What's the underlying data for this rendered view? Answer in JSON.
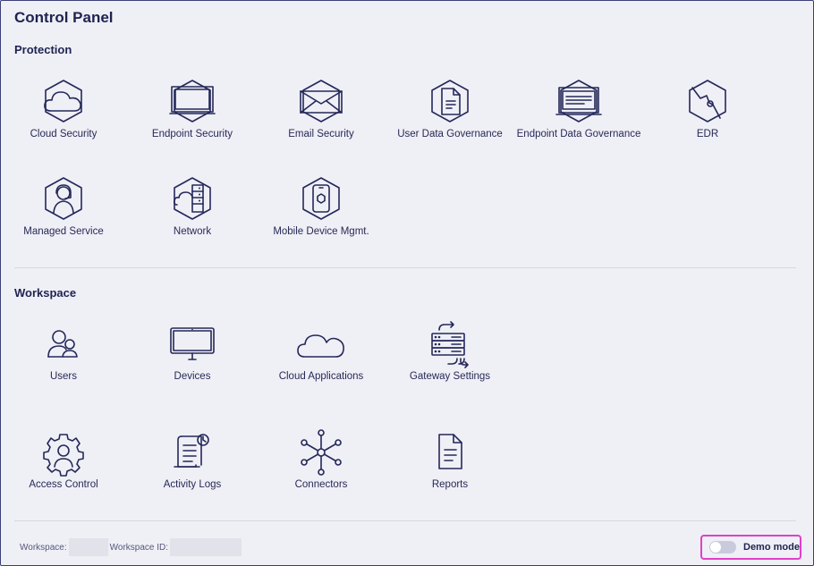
{
  "page": {
    "title": "Control Panel"
  },
  "protection": {
    "title": "Protection",
    "items": [
      {
        "label": "Cloud Security",
        "icon": "cloud-security-icon"
      },
      {
        "label": "Endpoint Security",
        "icon": "endpoint-security-icon"
      },
      {
        "label": "Email Security",
        "icon": "email-security-icon"
      },
      {
        "label": "User Data Governance",
        "icon": "user-data-governance-icon"
      },
      {
        "label": "Endpoint Data Governance",
        "icon": "endpoint-data-governance-icon"
      },
      {
        "label": "EDR",
        "icon": "edr-icon"
      },
      {
        "label": "Managed Service",
        "icon": "managed-service-icon"
      },
      {
        "label": "Network",
        "icon": "network-icon"
      },
      {
        "label": "Mobile Device Mgmt.",
        "icon": "mobile-device-icon"
      }
    ]
  },
  "workspace": {
    "title": "Workspace",
    "items": [
      {
        "label": "Users",
        "icon": "users-icon"
      },
      {
        "label": "Devices",
        "icon": "devices-icon"
      },
      {
        "label": "Cloud Applications",
        "icon": "cloud-icon"
      },
      {
        "label": "Gateway Settings",
        "icon": "gateway-icon"
      },
      {
        "label": "Access Control",
        "icon": "access-control-icon"
      },
      {
        "label": "Activity Logs",
        "icon": "activity-logs-icon"
      },
      {
        "label": "Connectors",
        "icon": "connectors-icon"
      },
      {
        "label": "Reports",
        "icon": "reports-icon"
      }
    ]
  },
  "footer": {
    "workspace_label": "Workspace:",
    "workspace_id_label": "Workspace ID:",
    "demo_mode_label": "Demo mode",
    "demo_mode_on": false
  },
  "colors": {
    "ink": "#232859",
    "background": "#efeff6",
    "highlight": "#e040c8"
  }
}
